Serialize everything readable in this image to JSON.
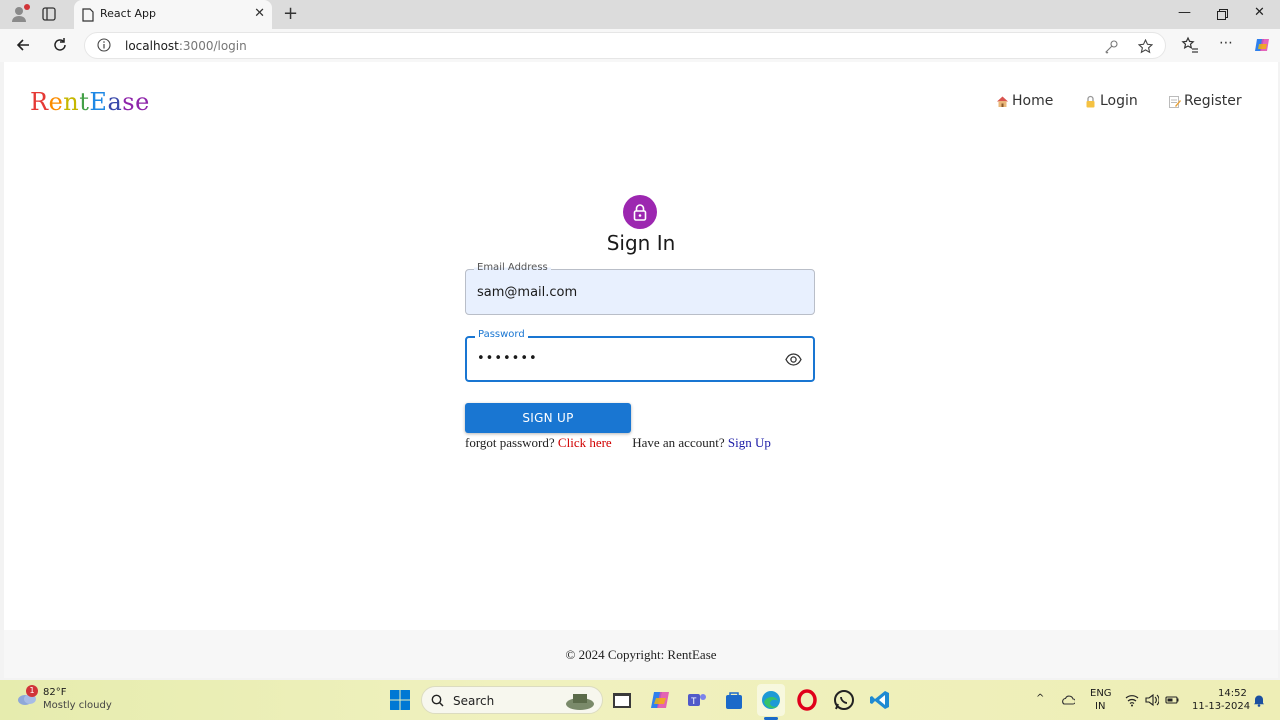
{
  "browser": {
    "tab_title": "React App",
    "url_host": "localhost",
    "url_rest": ":3000/login"
  },
  "site": {
    "brand_letters": [
      {
        "char": "R",
        "color": "#e53935"
      },
      {
        "char": "e",
        "color": "#fb8c00"
      },
      {
        "char": "n",
        "color": "#c6b700"
      },
      {
        "char": "t",
        "color": "#43a047"
      },
      {
        "char": "E",
        "color": "#1e88e5"
      },
      {
        "char": "a",
        "color": "#3949ab"
      },
      {
        "char": "s",
        "color": "#8e24aa"
      },
      {
        "char": "e",
        "color": "#8e24aa"
      }
    ],
    "nav": {
      "home": "Home",
      "login": "Login",
      "register": "Register"
    }
  },
  "form": {
    "title": "Sign In",
    "email_label": "Email Address",
    "email_value": "sam@mail.com",
    "password_label": "Password",
    "password_value": "•••••••",
    "submit_label": "SIGN UP",
    "forgot_prefix": "forgot password?",
    "forgot_link": "Click here",
    "account_prefix": "Have an account?",
    "account_link": "Sign Up"
  },
  "footer": {
    "text": "© 2024 Copyright: RentEase"
  },
  "taskbar": {
    "weather_badge": "1",
    "weather_temp": "82°F",
    "weather_desc": "Mostly cloudy",
    "search_label": "Search",
    "lang_top": "ENG",
    "lang_bottom": "IN",
    "time": "14:52",
    "date": "11-13-2024"
  },
  "colors": {
    "accent": "#1976d2",
    "lock": "#9c27b0"
  }
}
